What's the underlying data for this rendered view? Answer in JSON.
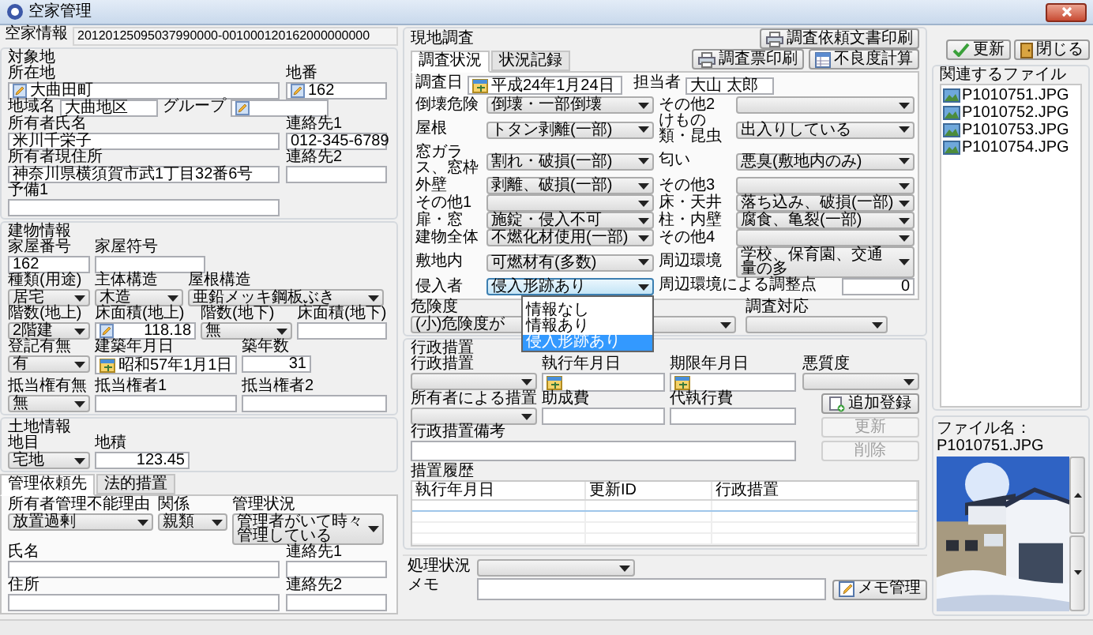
{
  "window": {
    "title": "空家管理"
  },
  "vacant_house": {
    "label": "空家情報",
    "id": "20120125095037990000-001000120162000000000"
  },
  "target_site": {
    "title": "対象地",
    "fields": [
      {
        "label": "所在地",
        "kind": "edit",
        "value": "大曲田町"
      },
      {
        "label": "地番",
        "kind": "edit",
        "value": "162"
      },
      {
        "label": "地域名",
        "kind": "text",
        "value": "大曲地区"
      },
      {
        "label": "グループ",
        "kind": "edit"
      },
      {
        "label": "所有者氏名",
        "kind": "text",
        "value": "米川千栄子"
      },
      {
        "label": "連絡先1",
        "kind": "text",
        "value": "012-345-6789"
      },
      {
        "label": "所有者現住所",
        "kind": "text",
        "value": "神奈川県横須賀市武1丁目32番6号"
      },
      {
        "label": "連絡先2",
        "kind": "text"
      },
      {
        "label": "予備1",
        "kind": "text"
      }
    ]
  },
  "building": {
    "title": "建物情報",
    "fields": [
      {
        "label": "家屋番号",
        "kind": "text",
        "value": "162"
      },
      {
        "label": "家屋符号",
        "kind": "text"
      },
      {
        "label": "種類(用途)",
        "kind": "select",
        "value": "居宅"
      },
      {
        "label": "主体構造",
        "kind": "select",
        "value": "木造"
      },
      {
        "label": "屋根構造",
        "kind": "select",
        "value": "亜鉛メッキ鋼板ぶき"
      },
      {
        "label": "階数(地上)",
        "kind": "select",
        "value": "2階建"
      },
      {
        "label": "床面積(地上)",
        "kind": "edit_number",
        "value": "118.18"
      },
      {
        "label": "階数(地下)",
        "kind": "select",
        "value": "無"
      },
      {
        "label": "床面積(地下)",
        "kind": "number"
      },
      {
        "label": "登記有無",
        "kind": "select",
        "value": "有"
      },
      {
        "label": "建築年月日",
        "kind": "date",
        "value": "昭和57年1月1日"
      },
      {
        "label": "築年数",
        "kind": "number",
        "value": "31"
      },
      {
        "label": "抵当権有無",
        "kind": "select",
        "value": "無"
      },
      {
        "label": "抵当権者1",
        "kind": "text"
      },
      {
        "label": "抵当権者2",
        "kind": "text"
      }
    ]
  },
  "land": {
    "title": "土地情報",
    "fields": [
      {
        "label": "地目",
        "kind": "select",
        "value": "宅地"
      },
      {
        "label": "地積",
        "kind": "number",
        "value": "123.45"
      }
    ]
  },
  "lower_tabs": [
    {
      "label": "管理依頼先",
      "selected": true
    },
    {
      "label": "法的措置",
      "selected": false
    }
  ],
  "management": {
    "fields": [
      {
        "label": "所有者管理不能理由",
        "kind": "select",
        "value": "放置過剰"
      },
      {
        "label": "関係",
        "kind": "select",
        "value": "親類"
      },
      {
        "label": "管理状況",
        "kind": "select",
        "value": "管理者がいて時々管理している"
      },
      {
        "label": "氏名",
        "kind": "text"
      },
      {
        "label": "連絡先1",
        "kind": "text"
      },
      {
        "label": "住所",
        "kind": "text"
      },
      {
        "label": "連絡先2",
        "kind": "text"
      }
    ]
  },
  "survey": {
    "title": "現地調査",
    "print_request": {
      "label": "調査依頼文書印刷",
      "kind": "print"
    },
    "tabs": [
      {
        "label": "調査状況",
        "selected": true
      },
      {
        "label": "状況記録",
        "selected": false
      }
    ],
    "buttons": [
      {
        "label": "調査票印刷",
        "kind": "print"
      },
      {
        "label": "不良度計算",
        "kind": "calc"
      }
    ],
    "date": {
      "label": "調査日",
      "kind": "date",
      "value": "平成24年1月24日"
    },
    "staff": {
      "label": "担当者",
      "kind": "text",
      "value": "大山 太郎"
    },
    "items_left": [
      {
        "label": "倒壊危険",
        "value": "倒壊・一部倒壊",
        "open": false
      },
      {
        "label": "屋根",
        "value": "トタン剥離(一部)",
        "open": false
      },
      {
        "label": "窓ガラス、窓枠",
        "value": "割れ・破損(一部)",
        "open": false
      },
      {
        "label": "外壁",
        "value": "剥離、破損(一部)",
        "open": false
      },
      {
        "label": "その他1",
        "open": false
      },
      {
        "label": "扉・窓",
        "value": "施錠・侵入不可",
        "open": false
      },
      {
        "label": "建物全体",
        "value": "不燃化材使用(一部)",
        "open": false
      },
      {
        "label": "敷地内",
        "value": "可燃材有(多数)",
        "open": false
      },
      {
        "label": "侵入者",
        "value": "侵入形跡あり",
        "open": true,
        "options": [
          {
            "label": "情報なし",
            "selected": false
          },
          {
            "label": "情報あり",
            "selected": false
          },
          {
            "label": "侵入形跡あり",
            "selected": true
          }
        ]
      }
    ],
    "items_right": [
      {
        "label": "その他2",
        "kind": "select"
      },
      {
        "label": "けもの類・昆虫",
        "kind": "select",
        "value": "出入りしている"
      },
      {
        "label": "匂い",
        "kind": "select",
        "value": "悪臭(敷地内のみ)"
      },
      {
        "label": "その他3",
        "kind": "select"
      },
      {
        "label": "床・天井",
        "kind": "select",
        "value": "落ち込み、破損(一部)"
      },
      {
        "label": "柱・内壁",
        "kind": "select",
        "value": "腐食、亀裂(一部)"
      },
      {
        "label": "その他4",
        "kind": "select"
      },
      {
        "label": "周辺環境",
        "kind": "select",
        "value": "学校、保育園、交通量の多"
      },
      {
        "label": "周辺環境による調整点",
        "kind": "number",
        "value": "0"
      }
    ],
    "danger": {
      "label": "危険度",
      "kind": "select",
      "value": "(小)危険度が"
    },
    "response": {
      "label": "調査対応",
      "kind": "select"
    }
  },
  "administrative": {
    "title": "行政措置",
    "fields": [
      {
        "label": "行政措置",
        "kind": "select"
      },
      {
        "label": "執行年月日",
        "kind": "date"
      },
      {
        "label": "期限年月日",
        "kind": "date"
      },
      {
        "label": "悪質度",
        "kind": "select"
      },
      {
        "label": "所有者による措置",
        "kind": "select"
      },
      {
        "label": "助成費",
        "kind": "text"
      },
      {
        "label": "代執行費",
        "kind": "text"
      }
    ],
    "buttons": [
      {
        "label": "追加登録",
        "kind": "add",
        "disabled": false
      },
      {
        "label": "更新",
        "kind": "plain",
        "disabled": true
      },
      {
        "label": "削除",
        "kind": "plain",
        "disabled": true
      }
    ],
    "remarks": {
      "label": "行政措置備考",
      "kind": "text"
    },
    "history": {
      "title": "措置履歴",
      "columns": [
        "執行年月日",
        "更新ID",
        "行政措置"
      ]
    }
  },
  "processing": {
    "label": "処理状況",
    "kind": "select"
  },
  "memo": {
    "label": "メモ",
    "kind": "text",
    "button": {
      "label": "メモ管理",
      "kind": "memo"
    }
  },
  "actions": [
    {
      "label": "更新",
      "kind": "update"
    },
    {
      "label": "閉じる",
      "kind": "close"
    }
  ],
  "related_files": {
    "title": "関連するファイル",
    "items": [
      {
        "name": "P1010751.JPG",
        "selected": false
      },
      {
        "name": "P1010752.JPG",
        "selected": false
      },
      {
        "name": "P1010753.JPG",
        "selected": false
      },
      {
        "name": "P1010754.JPG",
        "selected": false
      }
    ]
  },
  "preview": {
    "caption": "ファイル名：P1010751.JPG",
    "kind": "picture"
  }
}
